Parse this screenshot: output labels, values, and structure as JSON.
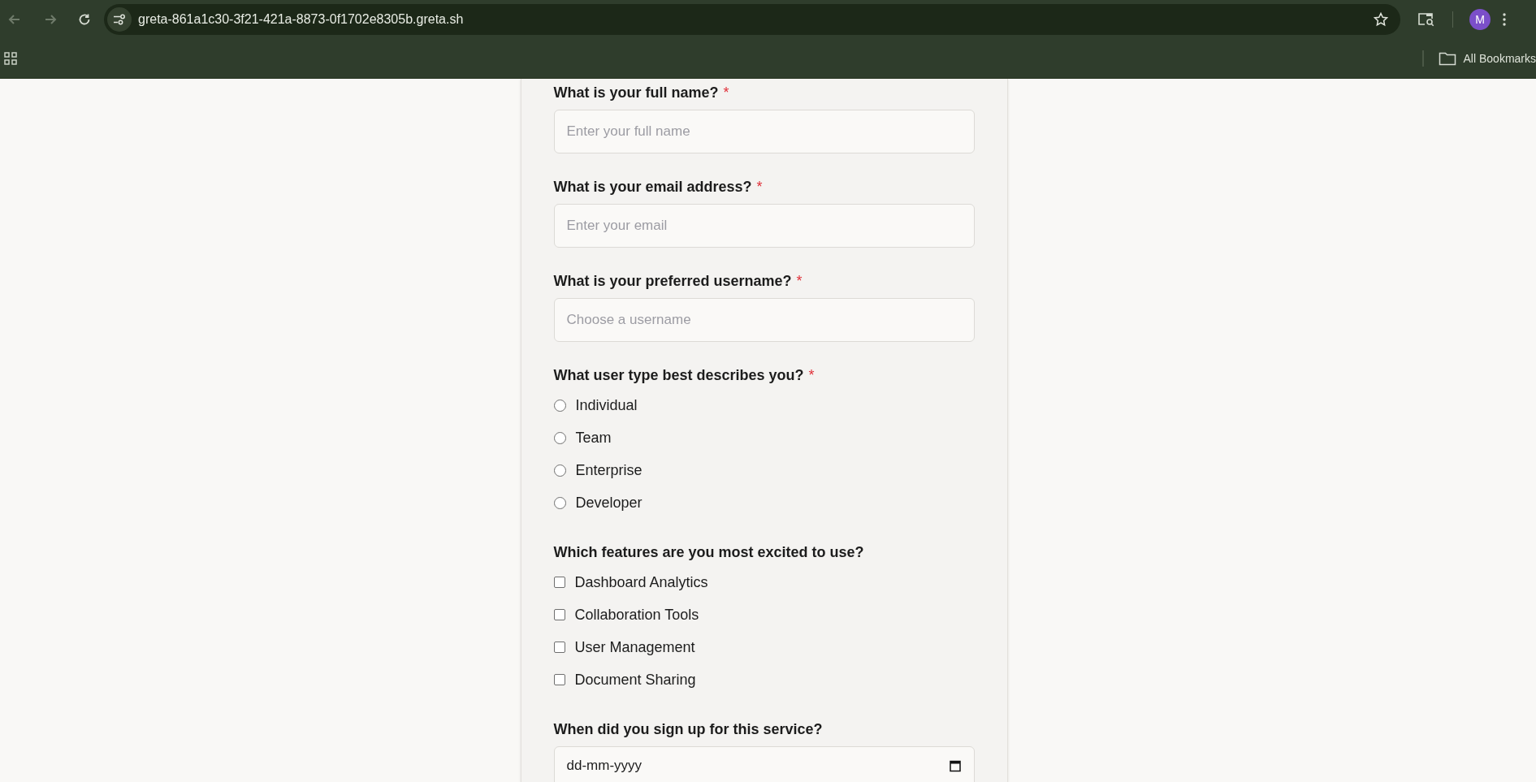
{
  "browser": {
    "url": "greta-861a1c30-3f21-421a-8873-0f1702e8305b.greta.sh",
    "back_disabled": true,
    "forward_disabled": true,
    "avatar": "M",
    "bookmarks_label": "All Bookmarks"
  },
  "form": {
    "questions": [
      {
        "kind": "text",
        "label": "What is your full name?",
        "required_mark": "*",
        "placeholder": "Enter your full name"
      },
      {
        "kind": "text",
        "label": "What is your email address?",
        "required_mark": "*",
        "placeholder": "Enter your email"
      },
      {
        "kind": "text",
        "label": "What is your preferred username?",
        "required_mark": "*",
        "placeholder": "Choose a username"
      },
      {
        "kind": "radio",
        "label": "What user type best describes you?",
        "required_mark": "*",
        "options": [
          {
            "label": "Individual",
            "selected": false
          },
          {
            "label": "Team",
            "selected": false
          },
          {
            "label": "Enterprise",
            "selected": false
          },
          {
            "label": "Developer",
            "selected": false
          }
        ]
      },
      {
        "kind": "checkbox",
        "label": "Which features are you most excited to use?",
        "options": [
          {
            "label": "Dashboard Analytics",
            "checked": false
          },
          {
            "label": "Collaboration Tools",
            "checked": false
          },
          {
            "label": "User Management",
            "checked": false
          },
          {
            "label": "Document Sharing",
            "checked": false
          }
        ]
      },
      {
        "kind": "date",
        "label": "When did you sign up for this service?",
        "format": "dd-mm-yyyy"
      }
    ]
  }
}
